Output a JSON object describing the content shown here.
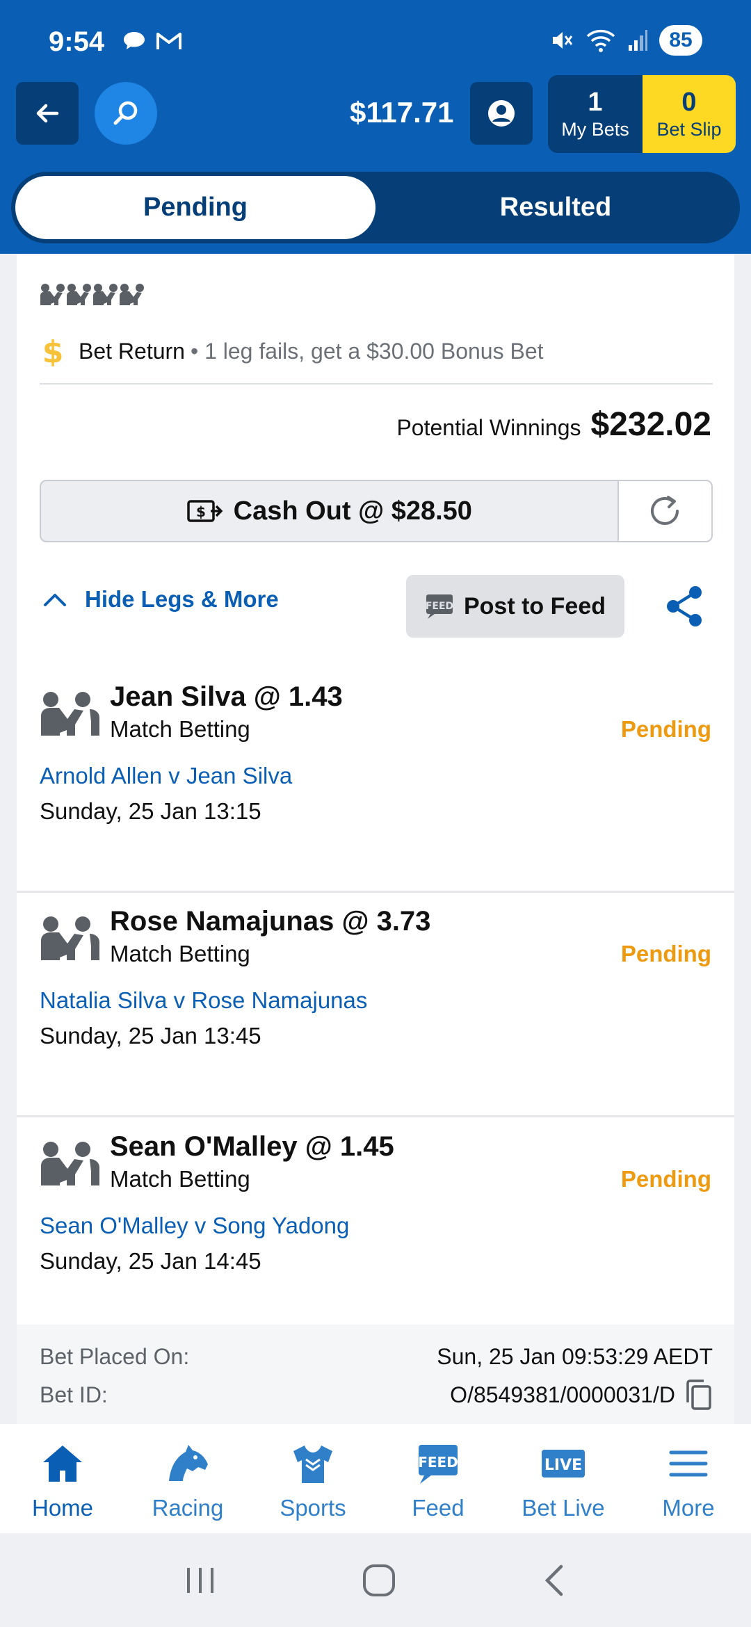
{
  "status_bar": {
    "time": "9:54",
    "battery": "85"
  },
  "header": {
    "balance": "$117.71",
    "my_bets_count": "1",
    "my_bets_label": "My Bets",
    "bet_slip_count": "0",
    "bet_slip_label": "Bet Slip"
  },
  "tabs": {
    "pending": "Pending",
    "resulted": "Resulted"
  },
  "bet": {
    "promo_title": "Bet Return",
    "promo_desc": "• 1 leg fails, get a $30.00 Bonus Bet",
    "potential_winnings_label": "Potential Winnings",
    "potential_winnings_value": "$232.02",
    "cash_out_label": "Cash Out @ $28.50",
    "hide_legs_label": "Hide Legs & More",
    "post_to_feed_label": "Post to Feed",
    "legs": [
      {
        "title": "Jean Silva @ 1.43",
        "market": "Match Betting",
        "status": "Pending",
        "event": "Arnold Allen v Jean Silva",
        "date": "Sunday, 25 Jan 13:15"
      },
      {
        "title": "Rose Namajunas @ 3.73",
        "market": "Match Betting",
        "status": "Pending",
        "event": "Natalia Silva v Rose Namajunas",
        "date": "Sunday, 25 Jan 13:45"
      },
      {
        "title": "Sean O'Malley @ 1.45",
        "market": "Match Betting",
        "status": "Pending",
        "event": "Sean O'Malley v Song Yadong",
        "date": "Sunday, 25 Jan 14:45"
      }
    ],
    "placed_on_label": "Bet Placed On:",
    "placed_on_value": "Sun, 25 Jan 09:53:29 AEDT",
    "bet_id_label": "Bet ID:",
    "bet_id_value": "O/8549381/0000031/D"
  },
  "bottom_nav": [
    {
      "label": "Home",
      "icon": "home-icon",
      "active": true
    },
    {
      "label": "Racing",
      "icon": "horse-head-icon"
    },
    {
      "label": "Sports",
      "icon": "jersey-icon"
    },
    {
      "label": "Feed",
      "icon": "feed-icon"
    },
    {
      "label": "Bet Live",
      "icon": "live-icon"
    },
    {
      "label": "More",
      "icon": "menu-icon"
    }
  ],
  "colors": {
    "brand_blue": "#0a5fb4",
    "navy": "#063e78",
    "yellow": "#fdd924",
    "pending_orange": "#ee9a11"
  },
  "icon_text": {
    "feed_badge": "FEED",
    "live_badge": "LIVE"
  }
}
